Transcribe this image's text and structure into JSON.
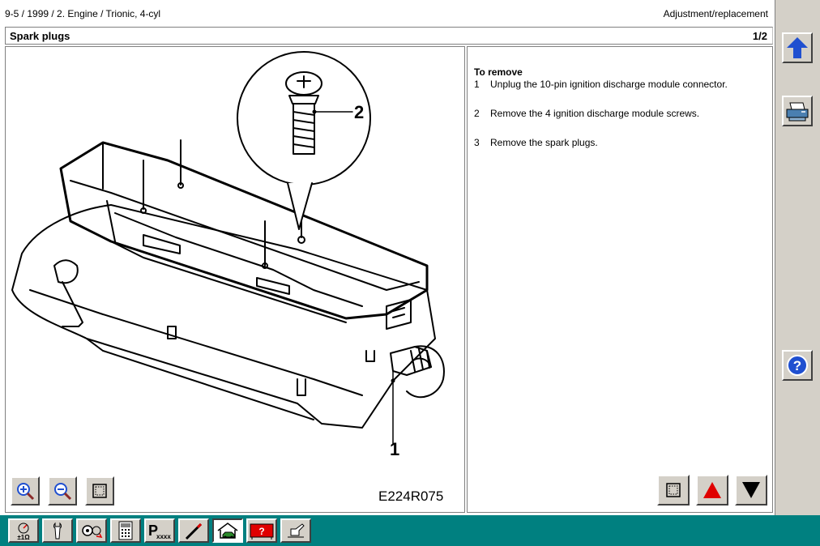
{
  "header": {
    "breadcrumb": "9-5 / 1999 / 2. Engine / Trionic, 4-cyl",
    "mode": "Adjustment/replacement",
    "title": "Spark plugs",
    "page": "1/2"
  },
  "illustration": {
    "code": "E224R075",
    "callouts": [
      "1",
      "2"
    ]
  },
  "instructions": {
    "heading": "To remove",
    "steps": [
      {
        "num": "1",
        "text": "Unplug the 10-pin ignition discharge module connector."
      },
      {
        "num": "2",
        "text": "Remove the 4 ignition discharge module screws."
      },
      {
        "num": "3",
        "text": "Remove the spark plugs."
      }
    ]
  },
  "colors": {
    "accent_blue": "#1f4fd0",
    "arrow_red": "#e00000",
    "taskbar": "#008080"
  }
}
